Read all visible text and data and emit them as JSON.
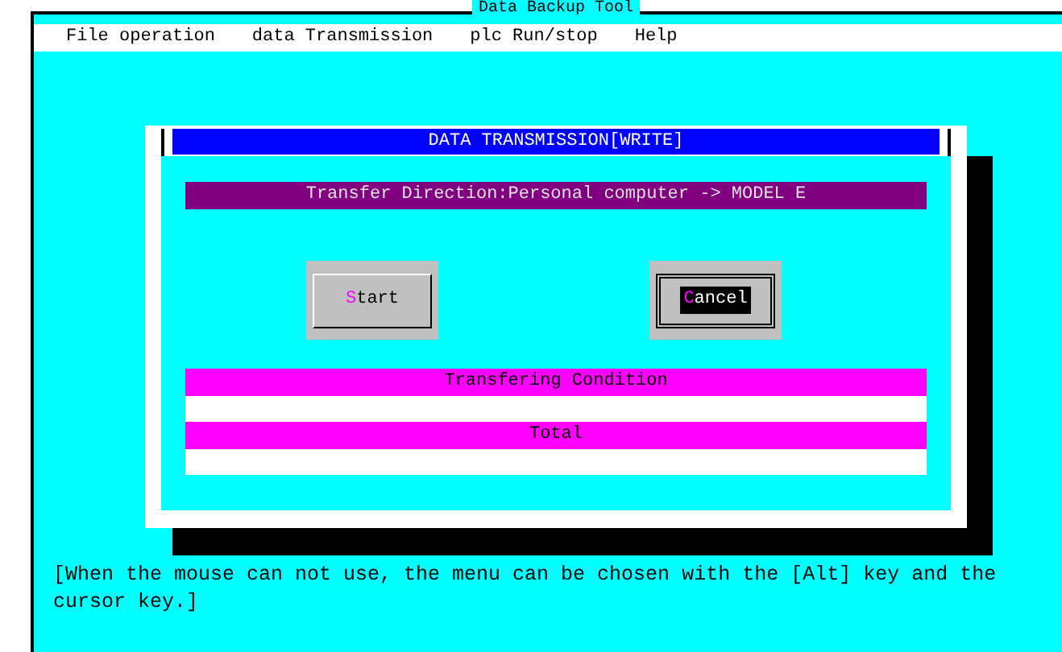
{
  "window": {
    "title": "Data Backup Tool"
  },
  "menu": [
    "File operation",
    "data Transmission",
    "plc Run/stop",
    "Help"
  ],
  "dialog": {
    "title": "DATA TRANSMISSION[WRITE]",
    "direction": "Transfer Direction:Personal computer -> MODEL E",
    "buttons": [
      {
        "label": "Start",
        "focused": false
      },
      {
        "label": "Cancel",
        "focused": true
      }
    ],
    "progress": [
      {
        "label": "Transfering Condition",
        "level": 0
      },
      {
        "label": "Total",
        "level": 0
      }
    ]
  },
  "hint": "[When the mouse can not use, the menu can be chosen with the [Alt] key and the cursor key.]"
}
